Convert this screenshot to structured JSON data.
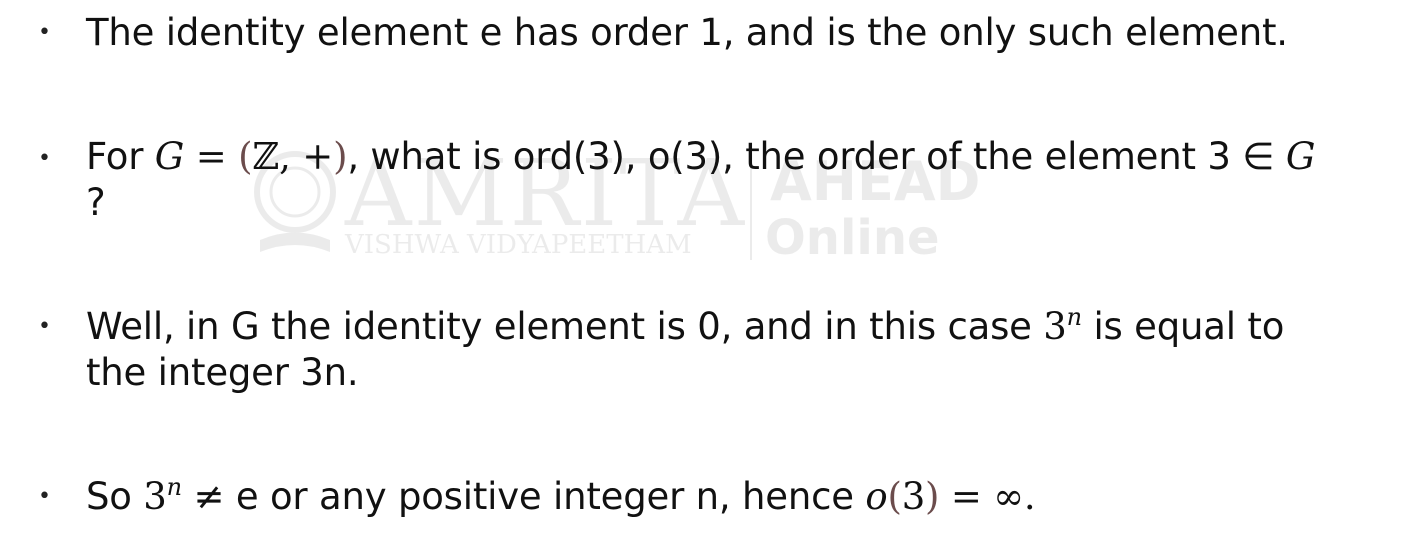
{
  "bullets": [
    {
      "line1": "The identity element e has order 1, and is the only such element."
    },
    {
      "prefix": "For ",
      "G": "G",
      "eq": " = ",
      "paren_open": "(",
      "set": "ℤ, +",
      "paren_close": ")",
      "middle": ", what is ord(3), o(3), the order of the element 3 ∈ ",
      "G2": "G",
      "line2": "?"
    },
    {
      "line1_pre": "Well, in G the identity element is 0, and in this case ",
      "base": "3",
      "exp": "n",
      "line1_post": " is equal to",
      "line2": "the integer 3n."
    },
    {
      "pre": "So ",
      "base": "3",
      "exp": "n",
      "mid": " ≠ e or any positive integer n, hence ",
      "o": "o",
      "paren_open": "(",
      "three": "3",
      "paren_close": ")",
      "end": " = ∞."
    }
  ],
  "watermark": {
    "main": "AMRITA",
    "sub": "VISHWA VIDYAPEETHAM",
    "right_top": "AHEAD",
    "right_bottom": "Online"
  }
}
